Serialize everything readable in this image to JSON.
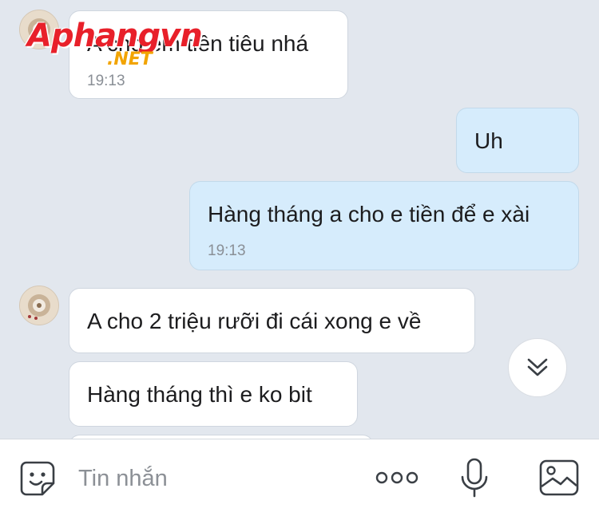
{
  "watermark": {
    "main": "Aphangvn",
    "sub": ".NET"
  },
  "messages": [
    {
      "direction": "incoming",
      "text": "A cho em tiền tiêu nhá",
      "time": "19:13"
    },
    {
      "direction": "outgoing",
      "text": "Uh"
    },
    {
      "direction": "outgoing",
      "text": "Hàng tháng a cho e tiền để e xài",
      "time": "19:13"
    },
    {
      "direction": "incoming",
      "text": "A cho 2 triệu rưỡi đi cái xong e về"
    },
    {
      "direction": "incoming",
      "text": "Hàng tháng thì e ko bit"
    }
  ],
  "composer": {
    "placeholder": "Tin nhắn"
  },
  "icons": {
    "emoji": "sticker-emoji-icon",
    "more": "more-options-icon",
    "mic": "microphone-icon",
    "image": "image-gallery-icon",
    "scroll": "scroll-down-chevron-icon"
  }
}
